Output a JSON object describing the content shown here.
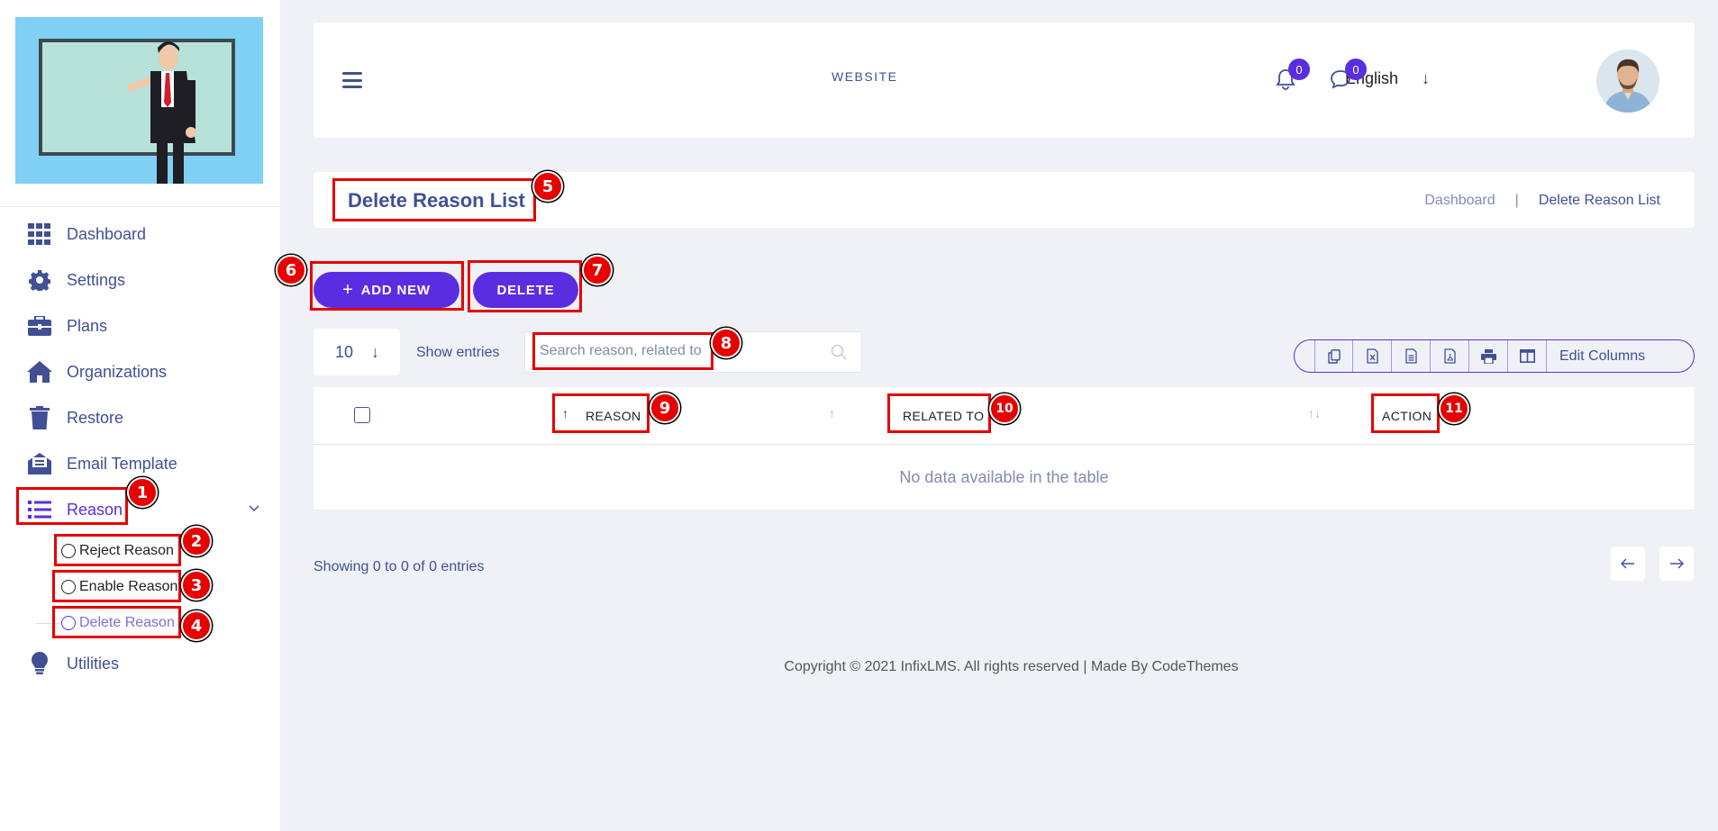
{
  "sidebar": {
    "items": [
      {
        "label": "Dashboard",
        "icon": "grid-icon"
      },
      {
        "label": "Settings",
        "icon": "gear-icon"
      },
      {
        "label": "Plans",
        "icon": "briefcase-icon"
      },
      {
        "label": "Organizations",
        "icon": "home-icon"
      },
      {
        "label": "Restore",
        "icon": "trash-icon"
      },
      {
        "label": "Email Template",
        "icon": "envelope-icon"
      },
      {
        "label": "Reason",
        "icon": "list-icon",
        "active": true
      },
      {
        "label": "Utilities",
        "icon": "lightbulb-icon"
      }
    ],
    "reason_sub": [
      {
        "label": "Reject Reason"
      },
      {
        "label": "Enable Reason"
      },
      {
        "label": "Delete Reason",
        "current": true
      }
    ]
  },
  "header": {
    "site_link": "WEBSITE",
    "language": "English",
    "notifications_count": "0",
    "messages_count": "0"
  },
  "page": {
    "title": "Delete Reason List",
    "breadcrumb": [
      "Dashboard",
      "|",
      "Delete Reason List"
    ]
  },
  "actions": {
    "add_new": "ADD NEW",
    "delete": "DELETE"
  },
  "controls": {
    "entries_value": "10",
    "show_entries": "Show entries",
    "search_placeholder": "Search reason, related to",
    "edit_columns": "Edit Columns"
  },
  "table": {
    "columns": [
      "REASON",
      "RELATED TO",
      "ACTION"
    ],
    "empty_message": "No data available in the table",
    "info": "Showing 0 to 0 of 0 entries"
  },
  "footer": {
    "copyright": "Copyright © 2021 InfixLMS. All rights reserved | Made By CodeThemes"
  },
  "annotations": [
    "1",
    "2",
    "3",
    "4",
    "5",
    "6",
    "7",
    "8",
    "9",
    "10",
    "11"
  ],
  "colors": {
    "primary": "#5b2de0",
    "text": "#415094",
    "annotation": "#e60000",
    "background": "#f0f1f7"
  }
}
